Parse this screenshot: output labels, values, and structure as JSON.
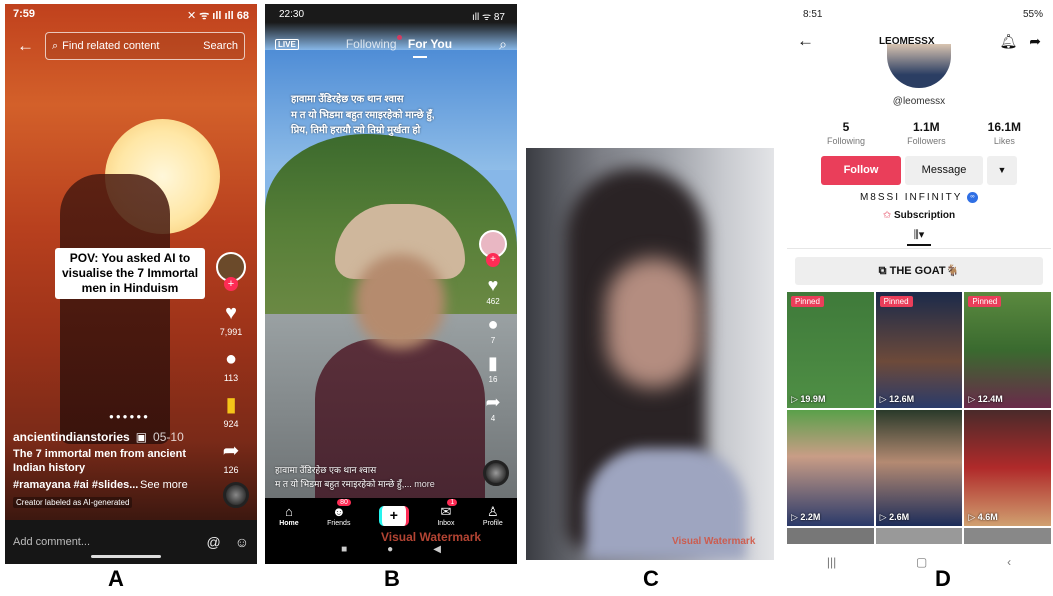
{
  "labels": [
    "A",
    "B",
    "C",
    "D"
  ],
  "panelA": {
    "status_time": "7:59",
    "status_right": "✕ ᯤ ıll ıll 68",
    "search_placeholder": "Find related content",
    "search_button": "Search",
    "overlay_caption": "POV: You asked AI to visualise the 7 Immortal men in Hinduism",
    "likes": "7,991",
    "comments": "113",
    "saves": "924",
    "shares": "126",
    "username": "ancientindianstories",
    "date": "05-10",
    "description": "The 7 immortal men from ancient Indian history",
    "tags": "#ramayana #ai #slides...",
    "see_more": "See more",
    "ai_label": "Creator labeled as AI-generated",
    "comment_placeholder": "Add comment...",
    "comment_icons": [
      "@",
      "☺"
    ],
    "colors": {
      "accent": "#fe2c55"
    }
  },
  "panelB": {
    "status_time": "22:30",
    "status_right": "ıll ᯤ 87",
    "tab_following": "Following",
    "tab_for_you": "For You",
    "live": "LIVE",
    "overlay_lines": [
      "हावामा उँडिरहेछ एक थान श्वास",
      "म त यो भिडमा बहुत रमाइरहेको मान्छे हुँ,",
      "प्रिय, तिमी हरायौ त्यो तिम्रो मुर्खता हो"
    ],
    "likes": "462",
    "comments": "7",
    "saves": "16",
    "shares": "4",
    "bottom_line1": "हावामा उँडिरहेछ एक थान श्वास",
    "bottom_line2": "म त यो भिडमा बहुत रमाइरहेको मान्छे हुँ,...",
    "more": "more",
    "nav": {
      "home": "Home",
      "friends": "Friends",
      "friends_badge": "80",
      "inbox": "Inbox",
      "inbox_badge": "1",
      "profile": "Profile"
    },
    "watermark": "Visual Watermark"
  },
  "panelC": {
    "watermark": "Visual Watermark"
  },
  "panelD": {
    "status_time": "8:51",
    "status_right": "55%",
    "title": "LEOMESSX",
    "handle": "@leomessx",
    "stats": [
      {
        "value": "5",
        "label": "Following"
      },
      {
        "value": "1.1M",
        "label": "Followers"
      },
      {
        "value": "16.1M",
        "label": "Likes"
      }
    ],
    "follow": "Follow",
    "message": "Message",
    "bio": "M8SSI INFINITY",
    "subscription": "Subscription",
    "playlist": "THE GOAT🐐",
    "videos": [
      {
        "pinned": "Pinned",
        "views": "19.9M"
      },
      {
        "pinned": "Pinned",
        "views": "12.6M"
      },
      {
        "pinned": "Pinned",
        "views": "12.4M"
      },
      {
        "pinned": "",
        "views": "2.2M"
      },
      {
        "pinned": "",
        "views": "2.6M"
      },
      {
        "pinned": "",
        "views": "4.6M"
      }
    ],
    "colors": {
      "follow": "#ea3e5a"
    }
  }
}
